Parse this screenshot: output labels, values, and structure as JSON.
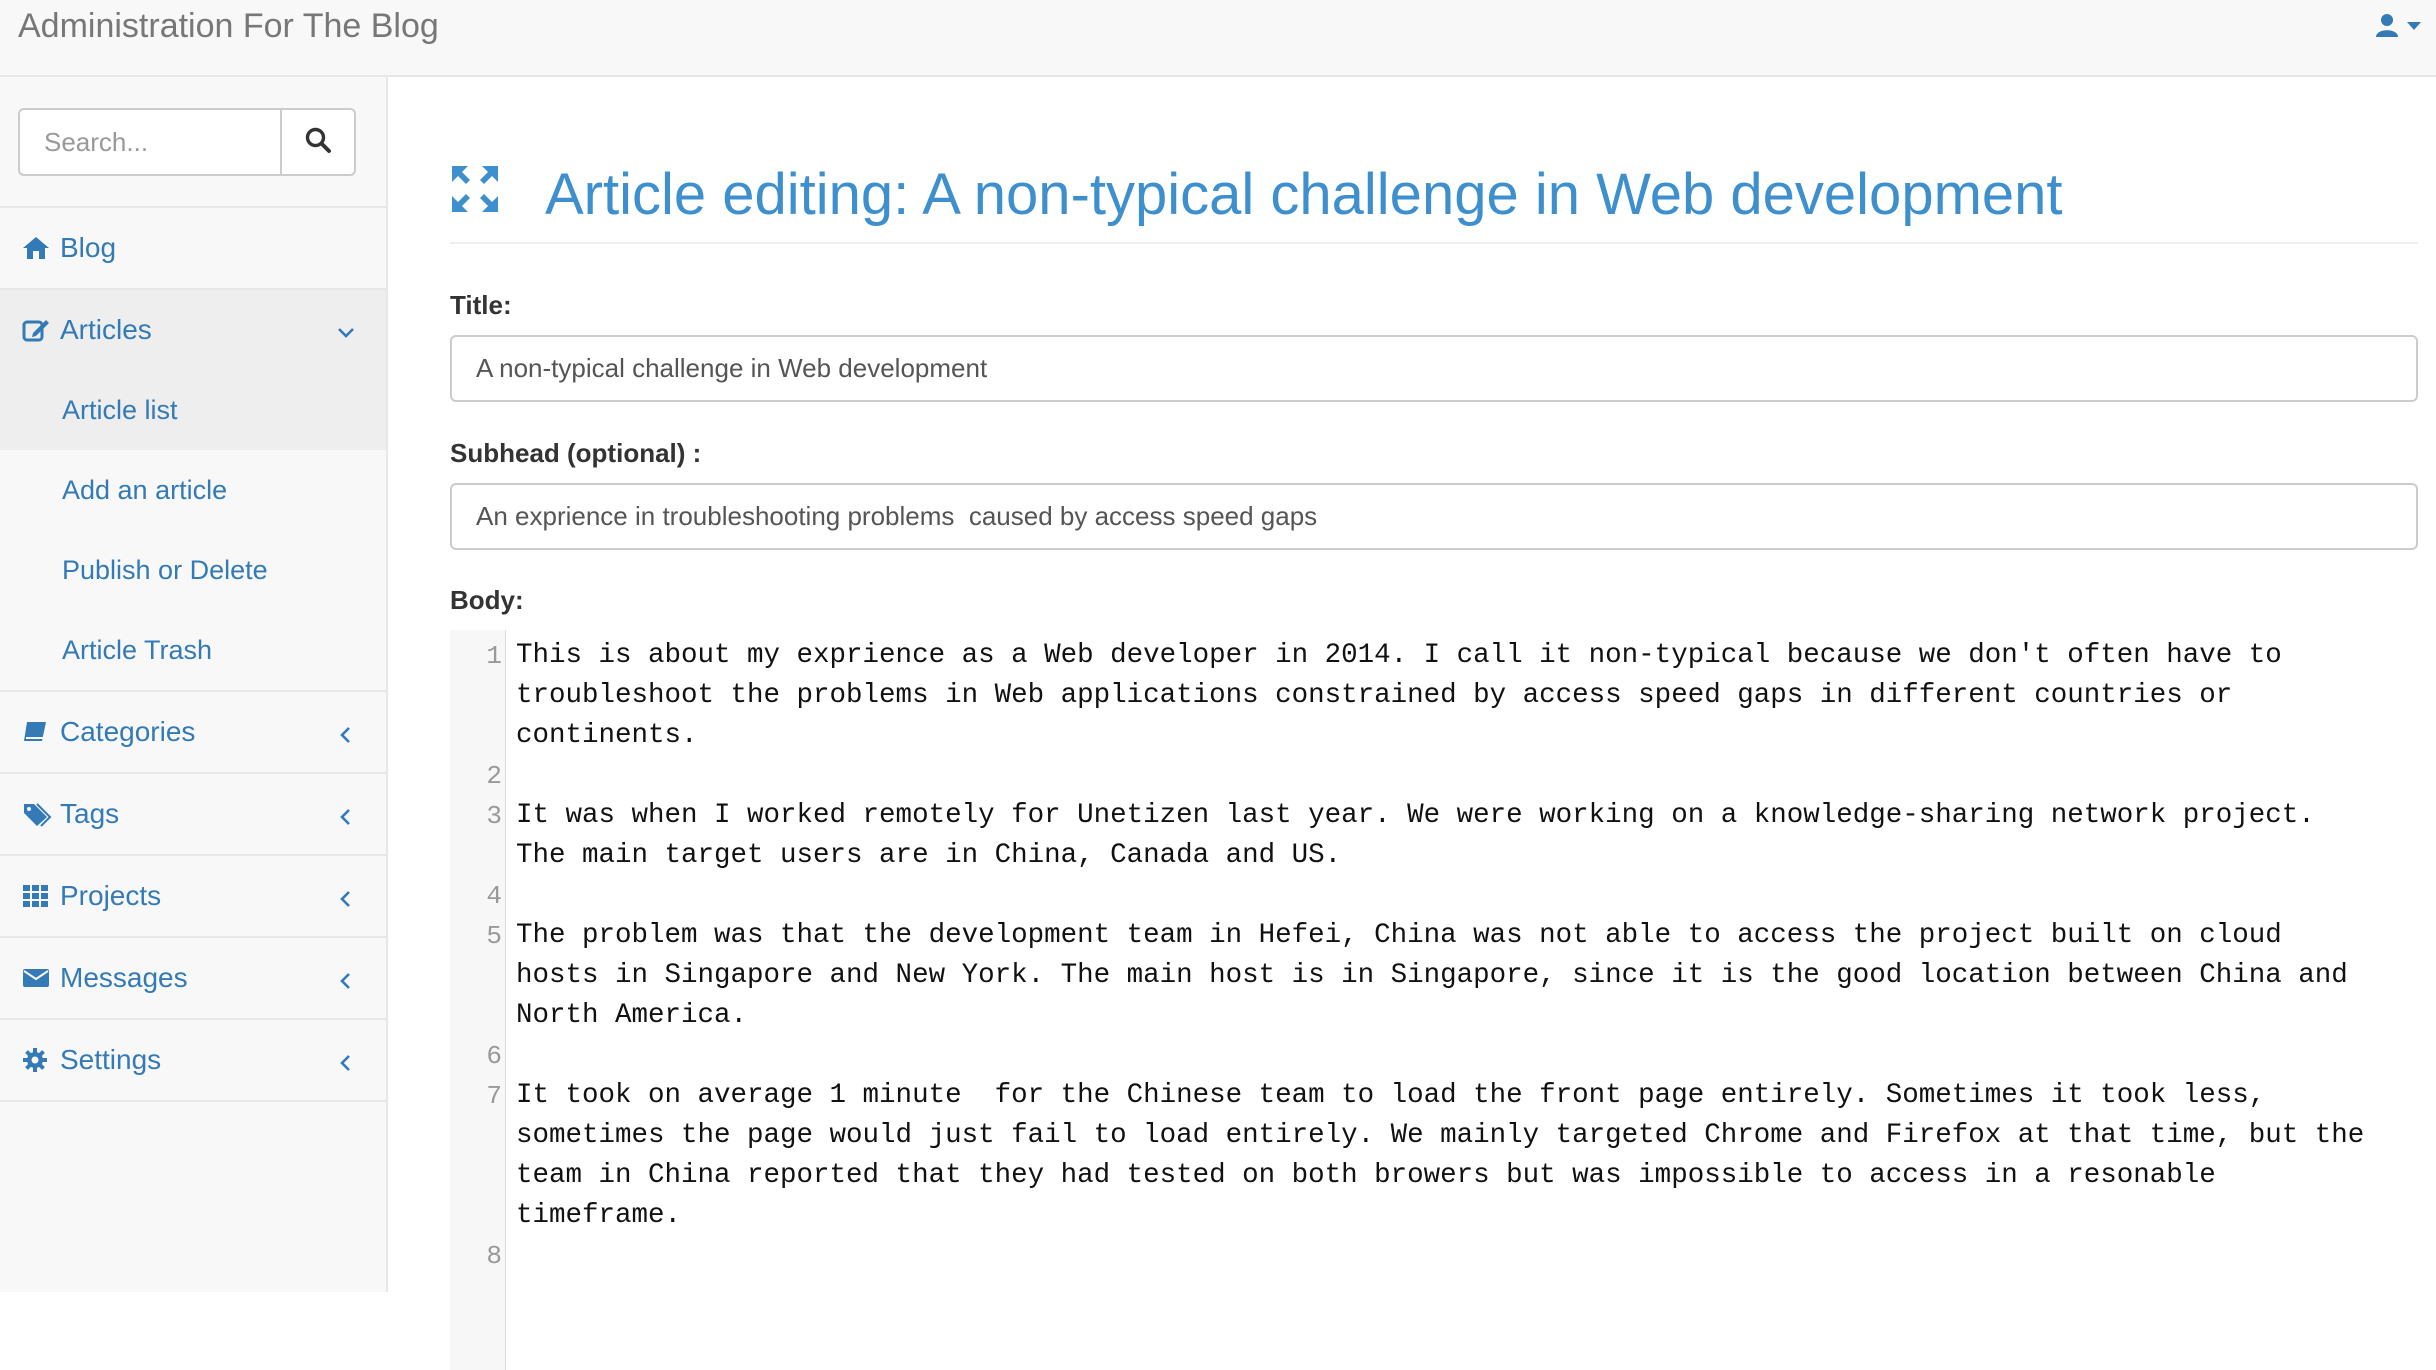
{
  "app": {
    "brand": "Administration For The Blog"
  },
  "search": {
    "placeholder": "Search..."
  },
  "nav": {
    "items": [
      {
        "label": "Blog",
        "icon": "home-icon"
      },
      {
        "label": "Articles",
        "icon": "edit-icon",
        "expanded": true,
        "children": [
          {
            "label": "Article list",
            "active": true
          },
          {
            "label": "Add an article"
          },
          {
            "label": "Publish or Delete"
          },
          {
            "label": "Article Trash"
          }
        ]
      },
      {
        "label": "Categories",
        "icon": "book-icon"
      },
      {
        "label": "Tags",
        "icon": "tags-icon"
      },
      {
        "label": "Projects",
        "icon": "grid-icon"
      },
      {
        "label": "Messages",
        "icon": "envelope-icon"
      },
      {
        "label": "Settings",
        "icon": "gear-icon"
      }
    ]
  },
  "page": {
    "title": "Article editing: A non-typical challenge in Web development"
  },
  "form": {
    "title_label": "Title:",
    "title_value": "A non-typical challenge in Web development",
    "subhead_label": "Subhead (optional) :",
    "subhead_value": "An exprience in troubleshooting problems  caused by access speed gaps",
    "body_label": "Body:"
  },
  "editor": {
    "lines": [
      {
        "n": "1",
        "text": "This is about my exprience as a Web developer in 2014. I call it non-typical because we don't often have to troubleshoot the problems in Web applications constrained by access speed gaps in different countries or continents."
      },
      {
        "n": "2",
        "text": ""
      },
      {
        "n": "3",
        "text": "It was when I worked remotely for Unetizen last year. We were working on a knowledge-sharing network project. The main target users are in China, Canada and US."
      },
      {
        "n": "4",
        "text": ""
      },
      {
        "n": "5",
        "text": "The problem was that the development team in Hefei, China was not able to access the project built on cloud hosts in Singapore and New York. The main host is in Singapore, since it is the good location between China and North America."
      },
      {
        "n": "6",
        "text": ""
      },
      {
        "n": "7",
        "text": "It took on average 1 minute  for the Chinese team to load the front page entirely. Sometimes it took less, sometimes the page would just fail to load entirely. We mainly targeted Chrome and Firefox at that time, but the team in China reported that they had tested on both browers but was impossible to access in a resonable timeframe."
      },
      {
        "n": "8",
        "text": ""
      }
    ]
  },
  "colors": {
    "accent": "#337ab7",
    "title": "#3d8fce",
    "topbar": "#f8f8f8",
    "border": "#e7e7e7"
  }
}
